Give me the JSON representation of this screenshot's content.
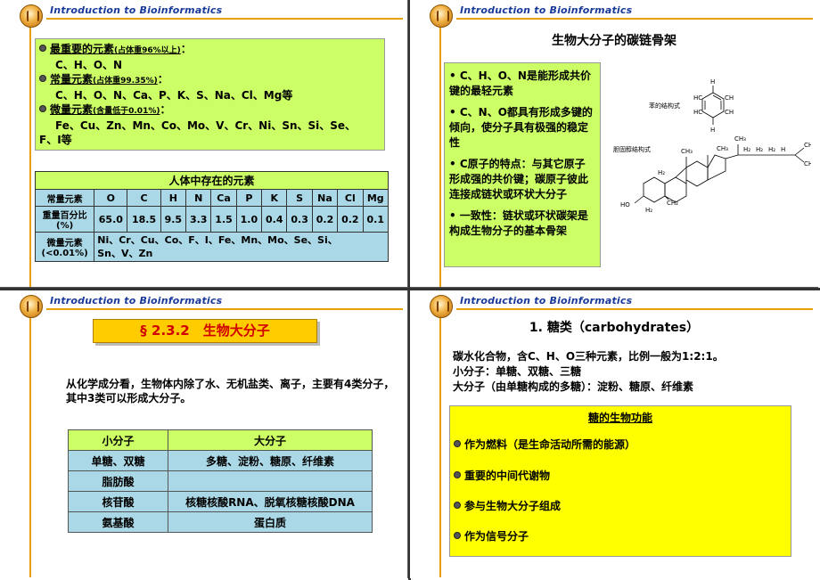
{
  "header_title": "Introduction to Bioinformatics",
  "slide1": {
    "items": [
      {
        "label": "最重要的元素",
        "note": "(占体重96%以上)",
        "colon": "：",
        "values": "C、H、O、N"
      },
      {
        "label": "常量元素",
        "note": "(占体重99.35%)",
        "colon": "：",
        "values": "C、H、O、N、Ca、P、K、S、Na、Cl、Mg等"
      },
      {
        "label": "微量元素",
        "note": "(含量低于0.01%)",
        "colon": "：",
        "values_line1": "Fe、Cu、Zn、Mn、Co、Mo、V、Cr、Ni、Sn、Si、Se、",
        "values_line2": "F、I等"
      }
    ],
    "table": {
      "title": "人体中存在的元素",
      "row1_label": "常量元素",
      "elements": [
        "O",
        "C",
        "H",
        "N",
        "Ca",
        "P",
        "K",
        "S",
        "Na",
        "Cl",
        "Mg"
      ],
      "row2_label_a": "重量百分比",
      "row2_label_b": "(%)",
      "percents": [
        "65.0",
        "18.5",
        "9.5",
        "3.3",
        "1.5",
        "1.0",
        "0.4",
        "0.3",
        "0.2",
        "0.2",
        "0.1"
      ],
      "row3_label_a": "微量元素",
      "row3_label_b": "(<0.01%)",
      "trace_line1": "Ni、Cr、Cu、Co、F、I、Fe、Mn、Mo、Se、Si、",
      "trace_line2": "Sn、V、Zn"
    }
  },
  "slide2": {
    "title": "生物大分子的碳链骨架",
    "points": [
      "• C、H、O、N是能形成共价键的最轻元素",
      "• C、N、O都具有形成多键的倾向，使分子具有极强的稳定性",
      "• C原子的特点：与其它原子形成强的共价键；碳原子彼此连接成链状或环状大分子",
      "• 一致性：链状或环状碳架是构成生物分子的基本骨架"
    ],
    "label_benzene": "苯的结构式",
    "label_cholesterol": "胆固醇结构式",
    "atom_oh": "HO"
  },
  "slide3": {
    "title": "§ 2.3.2　生物大分子",
    "text": "从化学成分看，生物体内除了水、无机盐类、离子，主要有4类分子，其中3类可以形成大分子。",
    "table": {
      "headers": [
        "小分子",
        "大分子"
      ],
      "rows": [
        [
          "单糖、双糖",
          "多糖、淀粉、糖原、纤维素"
        ],
        [
          "脂肪酸",
          ""
        ],
        [
          "核苷酸",
          "核糖核酸RNA、脱氧核糖核酸DNA"
        ],
        [
          "氨基酸",
          "蛋白质"
        ]
      ]
    }
  },
  "slide4": {
    "title": "1. 糖类（carbohydrates）",
    "lines": [
      "碳水化合物，含C、H、O三种元素，比例一般为1:2:1。",
      "小分子：单糖、双糖、三糖",
      "大分子（由单糖构成的多糖）：淀粉、糖原、纤维素"
    ],
    "box_title": "糖的生物功能",
    "functions": [
      "作为燃料（是生命活动所需的能源）",
      "重要的中间代谢物",
      "参与生物大分子组成",
      "作为信号分子"
    ]
  }
}
